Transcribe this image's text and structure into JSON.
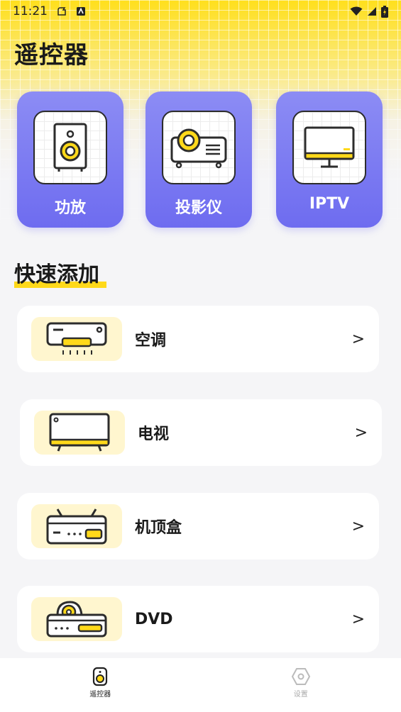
{
  "status_bar": {
    "time": "11:21"
  },
  "page_title": "遥控器",
  "device_cards": [
    {
      "label": "功放",
      "icon": "speaker-icon"
    },
    {
      "label": "投影仪",
      "icon": "projector-icon"
    },
    {
      "label": "IPTV",
      "icon": "tv-monitor-icon"
    }
  ],
  "quick_add": {
    "title": "快速添加",
    "items": [
      {
        "label": "空调",
        "icon": "air-conditioner-icon"
      },
      {
        "label": "电视",
        "icon": "television-icon"
      },
      {
        "label": "机顶盒",
        "icon": "set-top-box-icon"
      },
      {
        "label": "DVD",
        "icon": "dvd-player-icon"
      }
    ],
    "chevron": ">"
  },
  "bottom_nav": {
    "items": [
      {
        "label": "遥控器",
        "active": true
      },
      {
        "label": "设置",
        "active": false
      }
    ]
  },
  "colors": {
    "accent_yellow": "#ffd91a",
    "card_purple": "#7472f1",
    "thumb_bg": "#fff6cf"
  }
}
